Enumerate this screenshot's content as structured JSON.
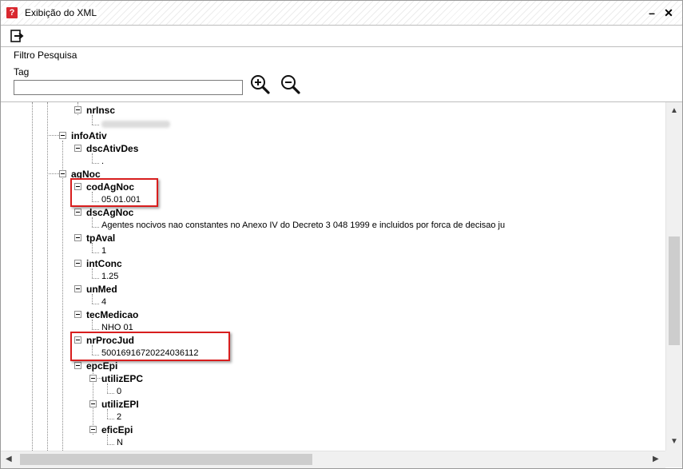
{
  "window": {
    "title": "Exibição do XML"
  },
  "title_controls": {
    "minimize": "–",
    "close": "✕"
  },
  "toolbar": {
    "exit_icon": "exit-icon"
  },
  "filter": {
    "title": "Filtro Pesquisa",
    "tag_label": "Tag",
    "tag_value": "",
    "zoom_in_icon": "zoom-in-icon",
    "zoom_out_icon": "zoom-out-icon"
  },
  "tree": {
    "nrInsc": {
      "label": "nrInsc"
    },
    "infoAtiv": {
      "label": "infoAtiv"
    },
    "dscAtivDes": {
      "label": "dscAtivDes",
      "value": "."
    },
    "agNoc": {
      "label": "agNoc"
    },
    "codAgNoc": {
      "label": "codAgNoc",
      "value": "05.01.001"
    },
    "dscAgNoc": {
      "label": "dscAgNoc",
      "value": "Agentes nocivos nao constantes no Anexo IV do Decreto 3 048 1999 e incluidos por forca de decisao ju"
    },
    "tpAval": {
      "label": "tpAval",
      "value": "1"
    },
    "intConc": {
      "label": "intConc",
      "value": "1.25"
    },
    "unMed": {
      "label": "unMed",
      "value": "4"
    },
    "tecMedicao": {
      "label": "tecMedicao",
      "value": "NHO 01"
    },
    "nrProcJud": {
      "label": "nrProcJud",
      "value": "50016916720224036112"
    },
    "epcEpi": {
      "label": "epcEpi"
    },
    "utilizEPC": {
      "label": "utilizEPC",
      "value": "0"
    },
    "utilizEPI": {
      "label": "utilizEPI",
      "value": "2"
    },
    "eficEpi": {
      "label": "eficEpi",
      "value": "N"
    }
  },
  "colors": {
    "highlight": "#d81e1e",
    "app_icon": "#d9282f"
  }
}
